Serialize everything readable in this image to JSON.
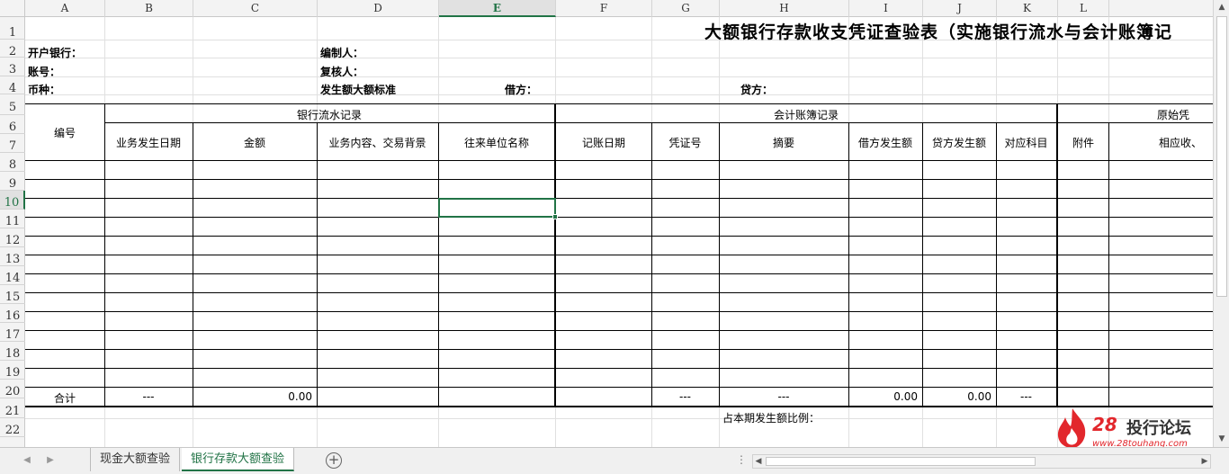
{
  "columns": [
    "A",
    "B",
    "C",
    "D",
    "E",
    "F",
    "G",
    "H",
    "I",
    "J",
    "K",
    "L"
  ],
  "selected_column": "E",
  "rows": [
    "1",
    "2",
    "3",
    "4",
    "5",
    "6",
    "7",
    "8",
    "9",
    "10",
    "11",
    "12",
    "13",
    "14",
    "15",
    "16",
    "17",
    "18",
    "19",
    "20",
    "21",
    "22"
  ],
  "selected_row": "10",
  "title": "大额银行存款收支凭证查验表（实施银行流水与会计账簿记",
  "info": {
    "bank_label": "开户银行：",
    "preparer_label": "编制人：",
    "account_label": "账号：",
    "reviewer_label": "复核人：",
    "currency_label": "币种：",
    "threshold_label": "发生额大额标准",
    "debit_label": "借方：",
    "credit_label": "贷方："
  },
  "headers": {
    "number": "编号",
    "bank_group": "银行流水记录",
    "ledger_group": "会计账簿记录",
    "original_group": "原始凭",
    "bank_date": "业务发生日期",
    "amount": "金额",
    "business": "业务内容、交易背景",
    "counterparty": "往来单位名称",
    "record_date": "记账日期",
    "voucher_no": "凭证号",
    "summary": "摘要",
    "debit_amount": "借方发生额",
    "credit_amount": "贷方发生额",
    "account": "对应科目",
    "attachment": "附件",
    "related": "相应收、"
  },
  "total_row": {
    "label": "合计",
    "b": "---",
    "c": "0.00",
    "g": "---",
    "h": "---",
    "i": "0.00",
    "j": "0.00",
    "k": "---"
  },
  "ratio_label": "占本期发生额比例：",
  "sheet_tabs": {
    "tab1": "现金大额查验",
    "tab2": "银行存款大额查验"
  },
  "watermark": {
    "number": "28",
    "name": "投行论坛",
    "url": "www.28touhang.com"
  }
}
